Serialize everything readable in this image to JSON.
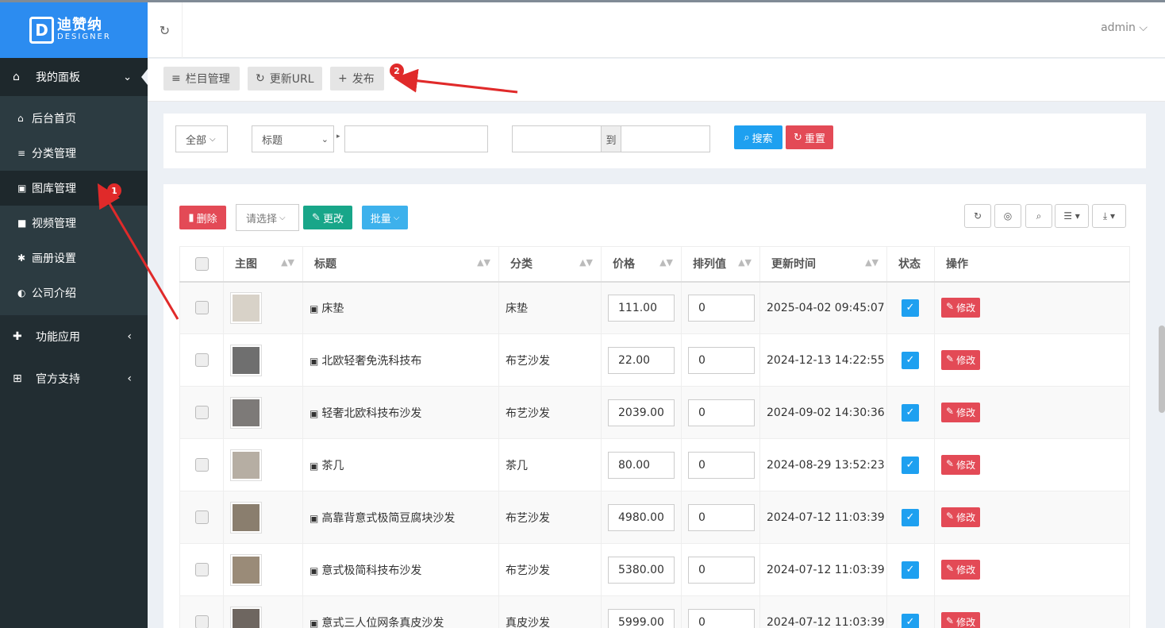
{
  "logo": {
    "cn": "迪赞纳",
    "en": "DESIGNER",
    "mark": "D"
  },
  "header": {
    "user": "admin ⌵"
  },
  "sidebar": {
    "top": {
      "label": "我的面板",
      "icon": "home-icon"
    },
    "items": [
      {
        "label": "后台首页",
        "icon": "home-icon"
      },
      {
        "label": "分类管理",
        "icon": "list-icon"
      },
      {
        "label": "图库管理",
        "icon": "image-icon"
      },
      {
        "label": "视频管理",
        "icon": "video-icon"
      },
      {
        "label": "画册设置",
        "icon": "gear-icon"
      },
      {
        "label": "公司介绍",
        "icon": "compass-icon"
      }
    ],
    "groups": [
      {
        "label": "功能应用",
        "icon": "puzzle-icon"
      },
      {
        "label": "官方支持",
        "icon": "plus-square-icon"
      }
    ]
  },
  "toolbar": {
    "column": "栏目管理",
    "update_url": "更新URL",
    "publish": "发布"
  },
  "annotations": {
    "one": "1",
    "two": "2"
  },
  "search": {
    "scope": "全部",
    "field": "标题",
    "to": "到",
    "search": "搜索",
    "reset": "重置"
  },
  "actions": {
    "delete": "删除",
    "select": "请选择",
    "change": "更改",
    "batch": "批量"
  },
  "table": {
    "headers": {
      "image": "主图",
      "title": "标题",
      "category": "分类",
      "price": "价格",
      "order": "排列值",
      "updated": "更新时间",
      "status": "状态",
      "ops": "操作"
    },
    "edit_label": "修改",
    "rows": [
      {
        "title": "床垫",
        "category": "床垫",
        "price": "111.00",
        "order": "0",
        "updated": "2025-04-02 09:45:07",
        "thumb": "#d8d2c8"
      },
      {
        "title": "北欧轻奢免洗科技布",
        "category": "布艺沙发",
        "price": "22.00",
        "order": "0",
        "updated": "2024-12-13 14:22:55",
        "thumb": "#6f6f6f"
      },
      {
        "title": "轻奢北欧科技布沙发",
        "category": "布艺沙发",
        "price": "2039.00",
        "order": "0",
        "updated": "2024-09-02 14:30:36",
        "thumb": "#7d7a78"
      },
      {
        "title": "茶几",
        "category": "茶几",
        "price": "80.00",
        "order": "0",
        "updated": "2024-08-29 13:52:23",
        "thumb": "#b6aea3"
      },
      {
        "title": "高靠背意式极简豆腐块沙发",
        "category": "布艺沙发",
        "price": "4980.00",
        "order": "0",
        "updated": "2024-07-12 11:03:39",
        "thumb": "#8a7e6e"
      },
      {
        "title": "意式极简科技布沙发",
        "category": "布艺沙发",
        "price": "5380.00",
        "order": "0",
        "updated": "2024-07-12 11:03:39",
        "thumb": "#9a8b78"
      },
      {
        "title": "意式三人位网条真皮沙发",
        "category": "真皮沙发",
        "price": "5999.00",
        "order": "0",
        "updated": "2024-07-12 11:03:39",
        "thumb": "#6e6660"
      }
    ]
  }
}
